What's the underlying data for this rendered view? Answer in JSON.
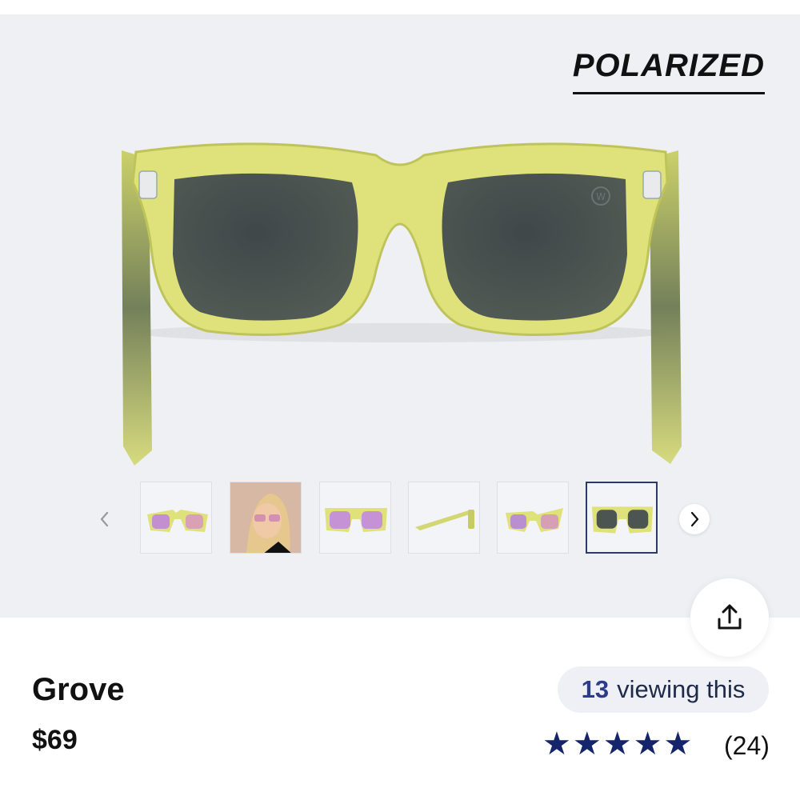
{
  "badge": "POLARIZED",
  "product": {
    "name": "Grove",
    "price": "$69",
    "viewing_count": "13",
    "viewing_suffix": "viewing this",
    "rating_stars": 5,
    "review_count": "(24)"
  },
  "gallery": {
    "thumbnails": [
      "front-angle-thumbnail",
      "model-wearing-thumbnail",
      "front-thumbnail",
      "side-thumbnail",
      "three-quarter-thumbnail",
      "back-thumbnail"
    ],
    "active_index": 5
  },
  "icons": {
    "prev": "chevron-left-icon",
    "next": "chevron-right-icon",
    "share": "share-icon",
    "star": "star-icon"
  },
  "colors": {
    "frame": "#dfe27a",
    "lens": "#4a5052",
    "accent": "#15256b",
    "hero_bg": "#eef0f4"
  }
}
